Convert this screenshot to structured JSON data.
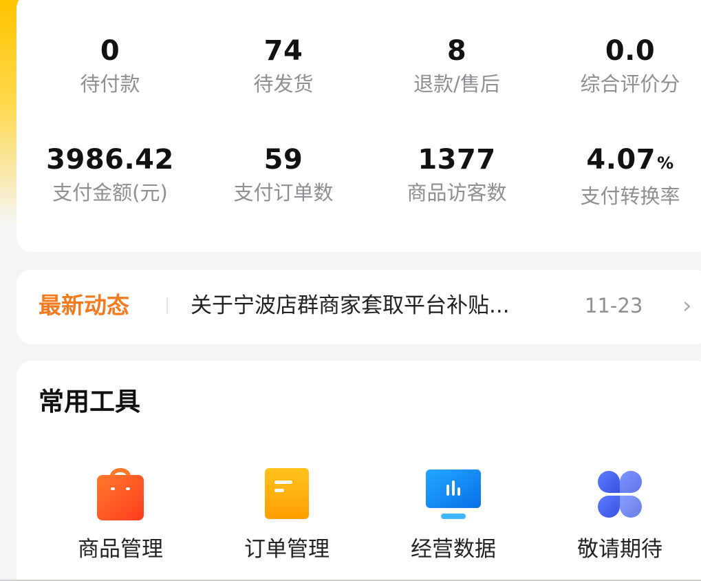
{
  "stats": {
    "row1": [
      {
        "value": "0",
        "label": "待付款"
      },
      {
        "value": "74",
        "label": "待发货"
      },
      {
        "value": "8",
        "label": "退款/售后"
      },
      {
        "value": "0.0",
        "label": "综合评价分"
      }
    ],
    "row2": [
      {
        "value": "3986.42",
        "label": "支付金额(元)"
      },
      {
        "value": "59",
        "label": "支付订单数"
      },
      {
        "value": "1377",
        "label": "商品访客数"
      },
      {
        "value": "4.07",
        "unit": "%",
        "label": "支付转换率"
      }
    ]
  },
  "news": {
    "title": "最新动态",
    "text": "关于宁波店群商家套取平台补贴...",
    "date": "11-23",
    "chevron": "›"
  },
  "tools": {
    "title": "常用工具",
    "items": [
      {
        "label": "商品管理",
        "icon": "shopping-bag-icon",
        "color": "#ff5a1f"
      },
      {
        "label": "订单管理",
        "icon": "order-document-icon",
        "color": "#ffb000"
      },
      {
        "label": "经营数据",
        "icon": "data-monitor-icon",
        "color": "#1a8cff"
      },
      {
        "label": "敬请期待",
        "icon": "four-petal-icon",
        "color": "#4f6bf0"
      }
    ]
  }
}
